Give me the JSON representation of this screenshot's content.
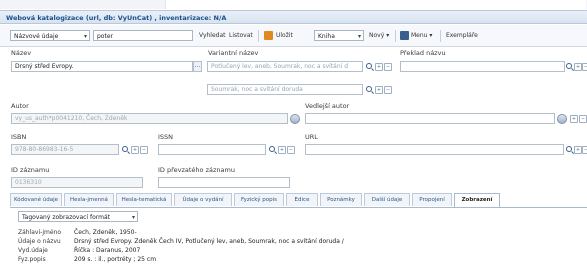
{
  "window": {
    "title": "Webová katalogizace (url, db: VyUnCat) , inventarizace: N/A"
  },
  "toolbar": {
    "search_field_select": "Názvové údaje",
    "search_query": "poter",
    "search_label": "Vyhledat",
    "list_label": "Listovat",
    "save_label": "Uložit",
    "doc_type_select": "Kniha",
    "new_label": "Nový",
    "menu_label": "Menu",
    "copies_label": "Exempláře"
  },
  "form": {
    "title_label": "Název",
    "title_value": "Drsný střed Evropy.",
    "variant_title_label": "Variantní název",
    "variant_title_value1": "Potlučený lev, aneb, Soumrak, noc a svítání d",
    "variant_title_value2": "Soumrak, noc a svítání doruda",
    "translation_title_label": "Překlad názvu",
    "author_label": "Autor",
    "author_value": "vy_us_auth*p0041210, Čech, Zdeněk",
    "secondary_author_label": "Vedlejší autor",
    "isbn_label": "ISBN",
    "isbn_value": "978-80-86983-16-5",
    "issn_label": "ISSN",
    "url_label": "URL",
    "record_id_label": "ID záznamu",
    "record_id_value": "0136310",
    "imported_id_label": "ID převzatého záznamu"
  },
  "tabs": [
    {
      "label": "Kódované údaje",
      "active": false
    },
    {
      "label": "Hesla-jmenná",
      "active": false
    },
    {
      "label": "Hesla-tematická",
      "active": false
    },
    {
      "label": "Údaje o vydání",
      "active": false
    },
    {
      "label": "Fyzický popis",
      "active": false
    },
    {
      "label": "Edice",
      "active": false
    },
    {
      "label": "Poznámky",
      "active": false
    },
    {
      "label": "Další údaje",
      "active": false
    },
    {
      "label": "Propojení",
      "active": false
    },
    {
      "label": "Zobrazení",
      "active": true
    }
  ],
  "display": {
    "format_select": "Tagovaný zobrazovací formát",
    "rows": [
      {
        "label": "Záhlaví-jméno",
        "value": "Čech, Zdeněk, 1950-"
      },
      {
        "label": "Údaje o názvu",
        "value": "Drsný střed Evropy. Zdeněk Čech IV, Potlučený lev, aneb, Soumrak, noc a svítání doruda /"
      },
      {
        "label": "Vyd.údaje",
        "value": "Říčka : Daranus, 2007"
      },
      {
        "label": "Fyz.popis",
        "value": "209 s. : il., portréty ; 25 cm"
      }
    ]
  },
  "colors": {
    "title_text": "#1b4f8a",
    "tab_text": "#2e5584",
    "save_icon": "#e08a1e",
    "menu_icon": "#3b5f8c"
  }
}
